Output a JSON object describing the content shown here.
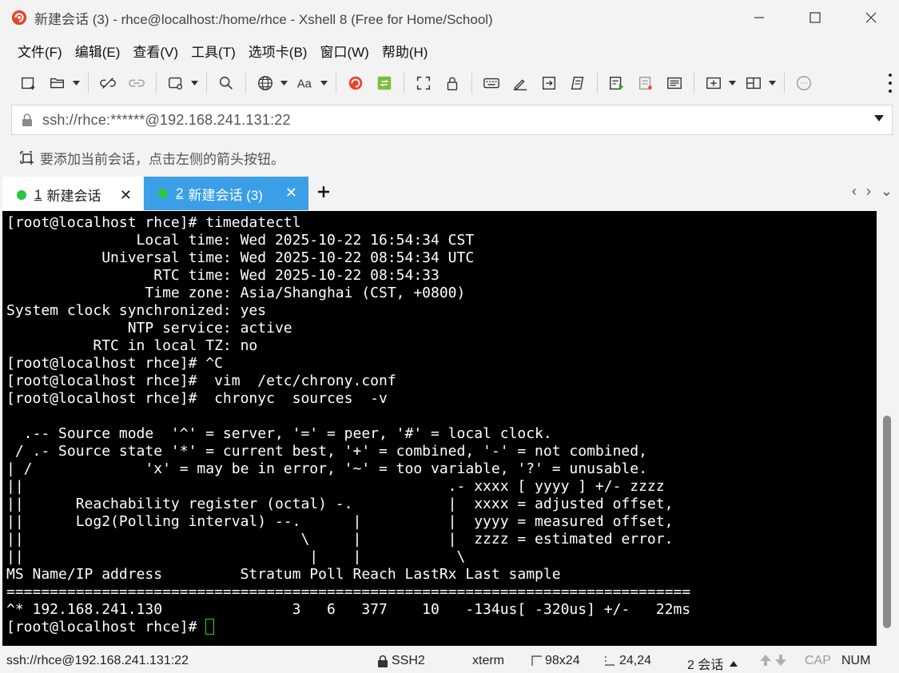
{
  "window": {
    "title": "新建会话 (3) - rhce@localhost:/home/rhce - Xshell 8 (Free for Home/School)",
    "accent": "#3b9fe8",
    "icon": "xshell-logo-icon"
  },
  "menu": {
    "items": [
      "文件(F)",
      "编辑(E)",
      "查看(V)",
      "工具(T)",
      "选项卡(B)",
      "窗口(W)",
      "帮助(H)"
    ]
  },
  "toolbar": {
    "icons": [
      "new-session-icon",
      "open-folder-icon",
      "disconnect-icon",
      "reconnect-icon",
      "new-window-icon",
      "search-icon",
      "globe-icon",
      "font-icon",
      "xshell-icon",
      "xftp-icon",
      "fullscreen-icon",
      "lock-icon",
      "keyboard-icon",
      "highlight-icon",
      "transfer-icon",
      "script-icon",
      "run-icon",
      "log-icon",
      "compose-icon",
      "add-tab-icon",
      "layout-icon",
      "chat-icon"
    ]
  },
  "address": {
    "value": "ssh://rhce:******@192.168.241.131:22"
  },
  "hint": {
    "text": "要添加当前会话，点击左侧的箭头按钮。"
  },
  "tabs": [
    {
      "index": "1",
      "label": "新建会话",
      "active": false,
      "status_color": "#28c840"
    },
    {
      "index": "2",
      "label": "新建会话 (3)",
      "active": true,
      "status_color": "#28c840"
    }
  ],
  "terminal": {
    "lines": [
      "[root@localhost rhce]# timedatectl",
      "               Local time: Wed 2025-10-22 16:54:34 CST",
      "           Universal time: Wed 2025-10-22 08:54:34 UTC",
      "                 RTC time: Wed 2025-10-22 08:54:33",
      "                Time zone: Asia/Shanghai (CST, +0800)",
      "System clock synchronized: yes",
      "              NTP service: active",
      "          RTC in local TZ: no",
      "[root@localhost rhce]# ^C",
      "[root@localhost rhce]#  vim  /etc/chrony.conf",
      "[root@localhost rhce]#  chronyc  sources  -v",
      "",
      "  .-- Source mode  '^' = server, '=' = peer, '#' = local clock.",
      " / .- Source state '*' = current best, '+' = combined, '-' = not combined,",
      "| /             'x' = may be in error, '~' = too variable, '?' = unusable.",
      "||                                                 .- xxxx [ yyyy ] +/- zzzz",
      "||      Reachability register (octal) -.           |  xxxx = adjusted offset,",
      "||      Log2(Polling interval) --.      |          |  yyyy = measured offset,",
      "||                                \\     |          |  zzzz = estimated error.",
      "||                                 |    |           \\",
      "MS Name/IP address         Stratum Poll Reach LastRx Last sample",
      "===============================================================================",
      "^* 192.168.241.130               3   6   377    10   -134us[ -320us] +/-   22ms"
    ],
    "prompt": "[root@localhost rhce]# "
  },
  "status": {
    "connection": "ssh://rhce@192.168.241.131:22",
    "protocol": "SSH2",
    "term": "xterm",
    "size": "98x24",
    "cursor_pos": "24,24",
    "sessions": "2 会话",
    "caps": "CAP",
    "num": "NUM"
  }
}
